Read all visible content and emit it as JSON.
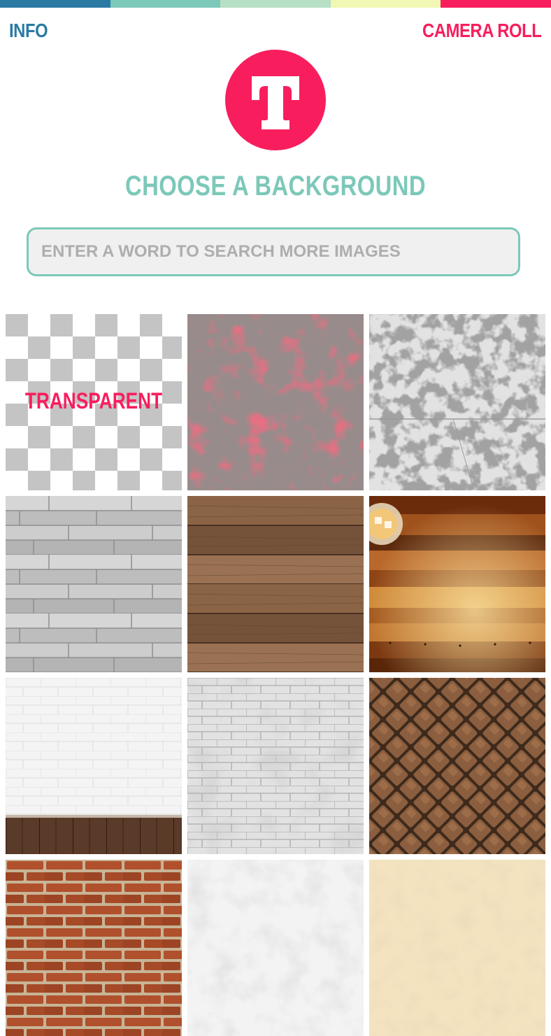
{
  "colors": {
    "stripes": [
      "#2a7aa4",
      "#7cc8b9",
      "#b6dfc6",
      "#f0f8b4",
      "#f81e5d"
    ],
    "info": "#2a7aa4",
    "camera_roll": "#f81e5d",
    "logo_bg": "#f81e5d",
    "logo_letter": "#ffffff",
    "title": "#7cc8b9",
    "search_border": "#7cc8b9",
    "transparent_label": "#f81e5d"
  },
  "nav": {
    "info_label": "INFO",
    "camera_roll_label": "CAMERA ROLL"
  },
  "logo": {
    "letter": "T",
    "icon": "text-t-logo-icon"
  },
  "title": "CHOOSE A BACKGROUND",
  "search": {
    "placeholder": "ENTER A WORD TO SEARCH MORE IMAGES",
    "value": ""
  },
  "backgrounds": [
    {
      "id": "transparent",
      "label": "TRANSPARENT"
    },
    {
      "id": "red-peeling-paint"
    },
    {
      "id": "white-peeling-paint"
    },
    {
      "id": "gray-wood-planks"
    },
    {
      "id": "brown-wood-planks"
    },
    {
      "id": "striped-wood-table"
    },
    {
      "id": "white-brick-wall-wood-floor"
    },
    {
      "id": "white-brick-wall"
    },
    {
      "id": "brown-cobblestone"
    },
    {
      "id": "red-brick-wall"
    },
    {
      "id": "white-crumpled-paper"
    },
    {
      "id": "cream-paper"
    }
  ]
}
